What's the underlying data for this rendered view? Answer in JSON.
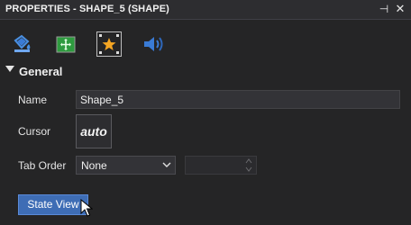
{
  "panel": {
    "title": "PROPERTIES - SHAPE_5 (SHAPE)",
    "pin_glyph": "⊣",
    "close_glyph": "✕"
  },
  "toolbar": {
    "buttons": [
      {
        "icon": "fill-bucket-icon",
        "selected": false
      },
      {
        "icon": "move-layout-icon",
        "selected": false
      },
      {
        "icon": "star-selection-icon",
        "selected": true
      },
      {
        "icon": "sound-speaker-icon",
        "selected": false
      }
    ]
  },
  "general": {
    "title": "General",
    "name_label": "Name",
    "name_value": "Shape_5",
    "cursor_label": "Cursor",
    "cursor_value": "auto",
    "tab_order_label": "Tab Order",
    "tab_order_value": "None",
    "tab_index_value": ""
  },
  "actions": {
    "state_view_label": "State View"
  },
  "colors": {
    "background": "#252526",
    "accent_button": "#3e6db5",
    "highlight_green": "#2e9b3f",
    "star_orange": "#f5a623",
    "icon_blue": "#3a7bd5"
  }
}
